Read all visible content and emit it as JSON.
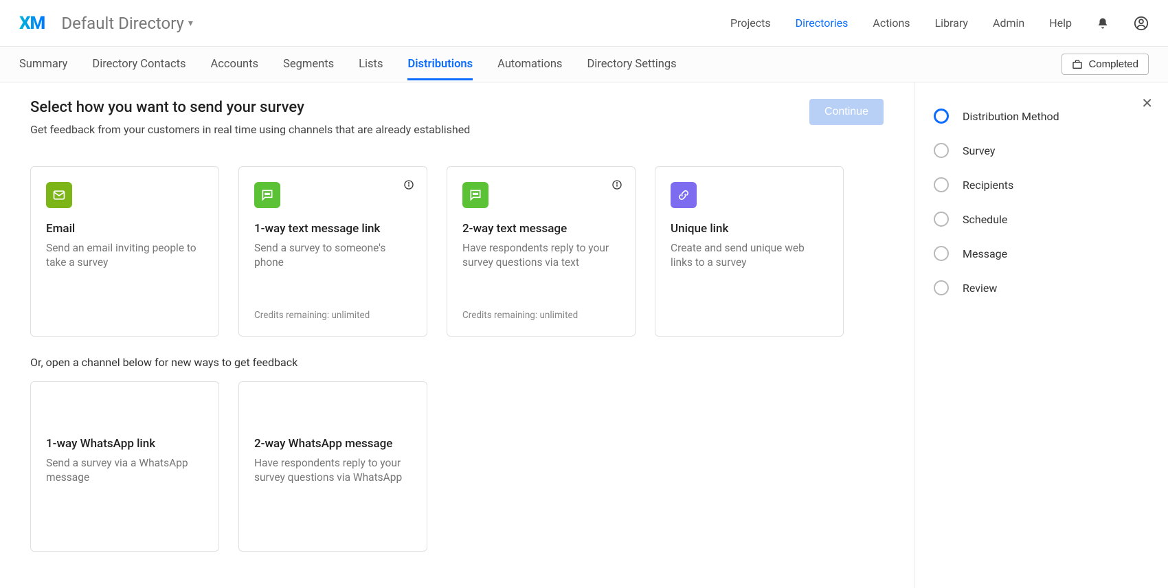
{
  "header": {
    "logo_text": "XM",
    "directory_title": "Default Directory",
    "topnav": {
      "projects": "Projects",
      "directories": "Directories",
      "actions": "Actions",
      "library": "Library",
      "admin": "Admin",
      "help": "Help"
    }
  },
  "subnav": {
    "tabs": {
      "summary": "Summary",
      "contacts": "Directory Contacts",
      "accounts": "Accounts",
      "segments": "Segments",
      "lists": "Lists",
      "distributions": "Distributions",
      "automations": "Automations",
      "settings": "Directory Settings"
    },
    "completed_label": "Completed"
  },
  "page": {
    "title": "Select how you want to send your survey",
    "subtitle": "Get feedback from your customers in real time using channels that are already established",
    "continue_label": "Continue",
    "second_section_label": "Or, open a channel below for new ways to get feedback"
  },
  "cards": {
    "email": {
      "title": "Email",
      "desc": "Send an email inviting people to take a survey"
    },
    "oneway_sms": {
      "title": "1-way text message link",
      "desc": "Send a survey to someone's phone",
      "credits": "Credits remaining: unlimited"
    },
    "twoway_sms": {
      "title": "2-way text message",
      "desc": "Have respondents reply to your survey questions via text",
      "credits": "Credits remaining: unlimited"
    },
    "unique_link": {
      "title": "Unique link",
      "desc": "Create and send unique web links to a survey"
    },
    "oneway_wa": {
      "title": "1-way WhatsApp link",
      "desc": "Send a survey via a WhatsApp message"
    },
    "twoway_wa": {
      "title": "2-way WhatsApp message",
      "desc": "Have respondents reply to your survey questions via WhatsApp"
    }
  },
  "sidepanel": {
    "steps": {
      "dist_method": "Distribution Method",
      "survey": "Survey",
      "recipients": "Recipients",
      "schedule": "Schedule",
      "message": "Message",
      "review": "Review"
    }
  }
}
